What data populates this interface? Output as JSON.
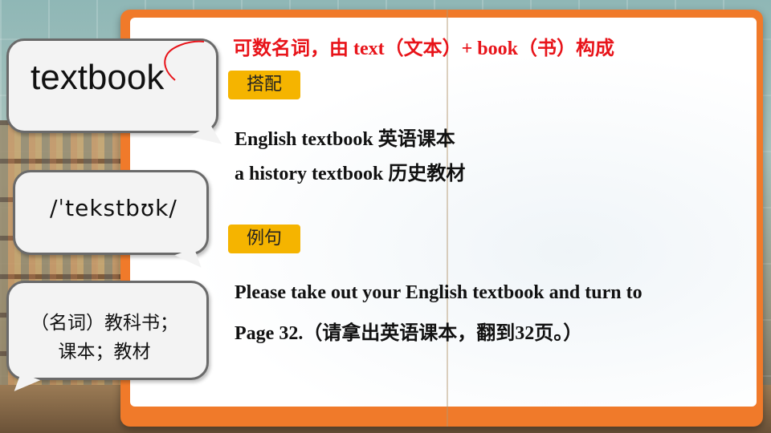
{
  "word": "textbook",
  "phonetic": "/ˈtekstbʊk/",
  "meaning": {
    "line1": "（名词）教科书；",
    "line2": "课本；教材"
  },
  "etymology": "可数名词，由 text（文本）+ book（书）构成",
  "collocation": {
    "label": "搭配",
    "items": [
      "English textbook 英语课本",
      "a history textbook 历史教材"
    ]
  },
  "example": {
    "label": "例句",
    "lines": [
      "Please take out your English textbook and turn to",
      "Page 32.（请拿出英语课本，翻到32页。）"
    ]
  },
  "colors": {
    "board": "#f07a2a",
    "tag": "#f5b400",
    "annotation": "#e8141a"
  }
}
